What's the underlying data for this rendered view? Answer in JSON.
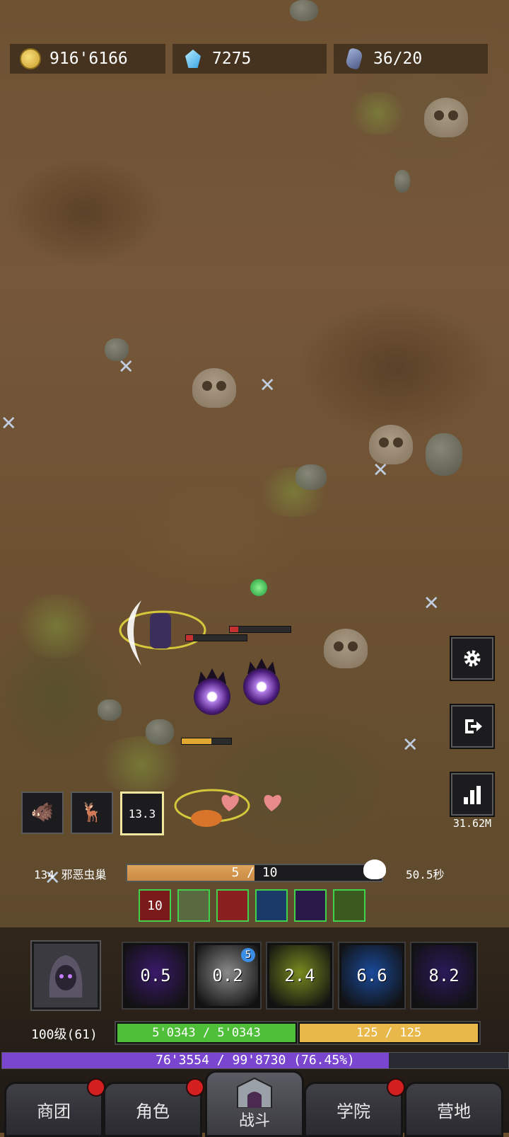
{
  "resources": {
    "gold": "916'6166",
    "gems": "7275",
    "stones": "36/20"
  },
  "side_buttons": {
    "dps_value": "31.62M"
  },
  "pets": [
    {
      "icon": "boar-pet-icon"
    },
    {
      "icon": "deer-pet-icon"
    },
    {
      "icon": "chest-pet-icon",
      "count": "13.3"
    }
  ],
  "wave": {
    "name": "134 邪恶虫巢",
    "progress_text": "5 / 10",
    "progress": 0.5,
    "timer": "50.5秒"
  },
  "buffs": [
    {
      "icon": "red-rune-icon",
      "label": "10",
      "color": "#7a1a1a"
    },
    {
      "icon": "warriors-icon",
      "label": "",
      "color": "#5a6a40"
    },
    {
      "icon": "serpent-icon",
      "label": "",
      "color": "#8a2020"
    },
    {
      "icon": "blue-spirit-icon",
      "label": "",
      "color": "#1a3a6a"
    },
    {
      "icon": "purple-shade-icon",
      "label": "",
      "color": "#2a1a4a"
    },
    {
      "icon": "boots-icon",
      "label": "",
      "color": "#3a5a20"
    }
  ],
  "skills": [
    {
      "icon": "shadow-slash-icon",
      "cooldown": "0.5",
      "color": "#3a1a6a",
      "badge": ""
    },
    {
      "icon": "whirlwind-icon",
      "cooldown": "0.2",
      "color": "#8a8a8a",
      "badge": "5"
    },
    {
      "icon": "swift-boots-icon",
      "cooldown": "2.4",
      "color": "#7a8a20",
      "badge": ""
    },
    {
      "icon": "frost-spirit-icon",
      "cooldown": "6.6",
      "color": "#1a4a9a",
      "badge": ""
    },
    {
      "icon": "void-phantom-icon",
      "cooldown": "8.2",
      "color": "#2a1a5a",
      "badge": ""
    }
  ],
  "player": {
    "level": "100级(61)",
    "hp_text": "5'0343 / 5'0343",
    "hp": 1.0,
    "mp_text": "125 / 125",
    "mp": 1.0,
    "xp_text": "76'3554 / 99'8730 (76.45%)",
    "xp": 0.7645
  },
  "tabs": [
    {
      "label": "商团",
      "notify": true
    },
    {
      "label": "角色",
      "notify": true
    },
    {
      "label": "战斗",
      "notify": false,
      "active": true
    },
    {
      "label": "学院",
      "notify": true
    },
    {
      "label": "营地",
      "notify": false
    }
  ],
  "colors": {
    "hp": "#4fbf3a",
    "mp": "#e8b84a",
    "xp": "#7a46d0",
    "notify": "#d42020"
  }
}
